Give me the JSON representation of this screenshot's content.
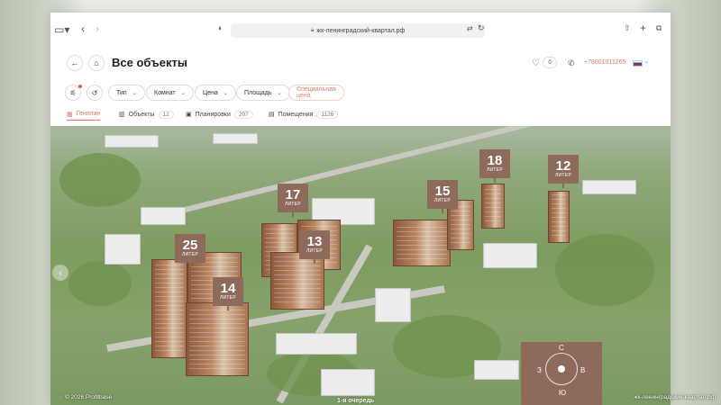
{
  "browser": {
    "url": "жк-ленинградский-квартал.рф"
  },
  "header": {
    "title": "Все объекты",
    "favorites_count": "0",
    "phone": "+78001011265"
  },
  "filters": [
    {
      "label": "Тип"
    },
    {
      "label": "Комнат"
    },
    {
      "label": "Цена"
    },
    {
      "label": "Площадь"
    },
    {
      "label": "Специальная цена"
    }
  ],
  "tabs": [
    {
      "label": "Генплан",
      "count": ""
    },
    {
      "label": "Объекты",
      "count": "12"
    },
    {
      "label": "Планировки",
      "count": "207"
    },
    {
      "label": "Помещения",
      "count": "1126"
    }
  ],
  "map": {
    "buildings": [
      {
        "number": "25",
        "sub": "ЛИТЕР"
      },
      {
        "number": "14",
        "sub": "ЛИТЕР"
      },
      {
        "number": "17",
        "sub": "ЛИТЕР"
      },
      {
        "number": "13",
        "sub": "ЛИТЕР"
      },
      {
        "number": "15",
        "sub": "ЛИТЕР"
      },
      {
        "number": "18",
        "sub": "ЛИТЕР"
      },
      {
        "number": "12",
        "sub": "ЛИТЕР"
      }
    ],
    "queue_label": "1-я очередь",
    "compass": {
      "n": "С",
      "s": "Ю",
      "w": "З",
      "e": "В"
    }
  },
  "footer": {
    "copyright": "© 2026 Profitbase",
    "source": "жк-ленинградский-квартал.рф"
  }
}
